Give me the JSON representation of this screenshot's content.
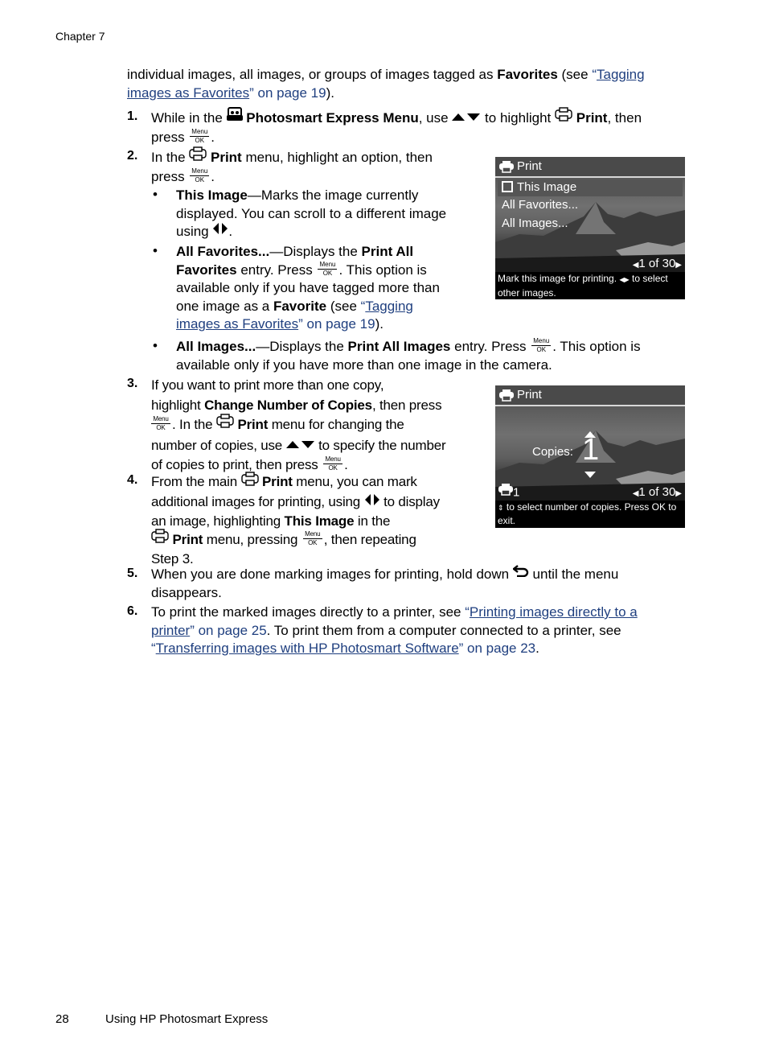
{
  "header": {
    "chapter": "Chapter 7"
  },
  "footer": {
    "page_number": "28",
    "section_title": "Using HP Photosmart Express"
  },
  "intro": {
    "text1": "individual images, all images, or groups of images tagged as ",
    "bold1": "Favorites",
    "text2": " (see ",
    "link_open_quote": "“",
    "link_part1": "Tagging",
    "link_part2": "images as Favorites",
    "link_close": "” on page 19",
    "text3": ")."
  },
  "icons": {
    "menu_ok_top": "Menu",
    "menu_ok_bottom": "OK"
  },
  "steps": [
    {
      "number": "1.",
      "a": "While in the ",
      "b_bold": "Photosmart Express Menu",
      "c": ", use ",
      "d": " to highlight ",
      "e_bold": "Print",
      "f": ", then",
      "g": "press ",
      "h": "."
    },
    {
      "number": "2.",
      "a": "In the ",
      "b_bold": "Print",
      "c": " menu, highlight an option, then",
      "d": "press ",
      "e": "."
    },
    {
      "number": "3.",
      "l1": "If you want to print more than one copy,",
      "l2a": "highlight ",
      "l2b": "Change Number of Copies",
      "l2c": ", then press",
      "l3a": ". In the ",
      "l3b": "Print",
      "l3c": " menu for changing the",
      "l4a": "number of copies, use ",
      "l4b": " to specify the number",
      "l5a": "of copies to print, then press ",
      "l5b": "."
    },
    {
      "number": "4.",
      "l1a": "From the main ",
      "l1b": "Print",
      "l1c": " menu, you can mark",
      "l2a": "additional images for printing, using ",
      "l2b": " to display",
      "l3a": "an image, highlighting ",
      "l3b": "This Image",
      "l3c": " in the",
      "l4a": "Print",
      "l4b": " menu, pressing ",
      "l4c": ", then repeating",
      "l5": "Step 3."
    },
    {
      "number": "5.",
      "l1a": "When you are done marking images for printing, hold down ",
      "l1b": " until the menu",
      "l2": "disappears."
    },
    {
      "number": "6.",
      "l1a": "To print the marked images directly to a printer, see ",
      "l1q": "“",
      "l1link": "Printing images directly to a",
      "l2link": "printer",
      "l2q": "” on page 25",
      "l2b": ". To print them from a computer connected to a printer, see",
      "l3q": "“",
      "l3link": "Transferring images with HP Photosmart Software",
      "l3q2": "” on page 23",
      "l3b": "."
    }
  ],
  "bullets": [
    {
      "bold": "This Image",
      "l1": "—Marks the image currently",
      "l2": "displayed. You can scroll to a different image",
      "l3a": "using ",
      "l3b": "."
    },
    {
      "bold": "All Favorites...",
      "l1a": "—Displays the ",
      "l1b": "Print All",
      "l2a": "Favorites",
      "l2b": " entry. Press ",
      "l2c": ". This option is",
      "l3": "available only if you have tagged more than",
      "l4a": "one image as a ",
      "l4b": "Favorite",
      "l4c": " (see ",
      "l4q": "“",
      "l4link": "Tagging",
      "l5link": "images as Favorites",
      "l5q": "” on page 19",
      "l5c": ")."
    },
    {
      "bold": "All Images...",
      "l1a": "—Displays the ",
      "l1b": "Print All Images",
      "l1c": " entry. Press ",
      "l1d": ". This option is",
      "l2": "available only if you have more than one image in the camera."
    }
  ],
  "screen1": {
    "title": "Print",
    "items": [
      "This Image",
      "All Favorites...",
      "All Images..."
    ],
    "selected_index": 0,
    "counter": "1 of 30",
    "caption_a": "Mark this image for printing. ",
    "caption_b": " to select other images."
  },
  "screen2": {
    "title": "Print",
    "copies_label": "Copies:",
    "copies_value": "1",
    "print_count": "1",
    "counter": "1 of 30",
    "caption": " to select number of copies.  Press OK to exit."
  }
}
